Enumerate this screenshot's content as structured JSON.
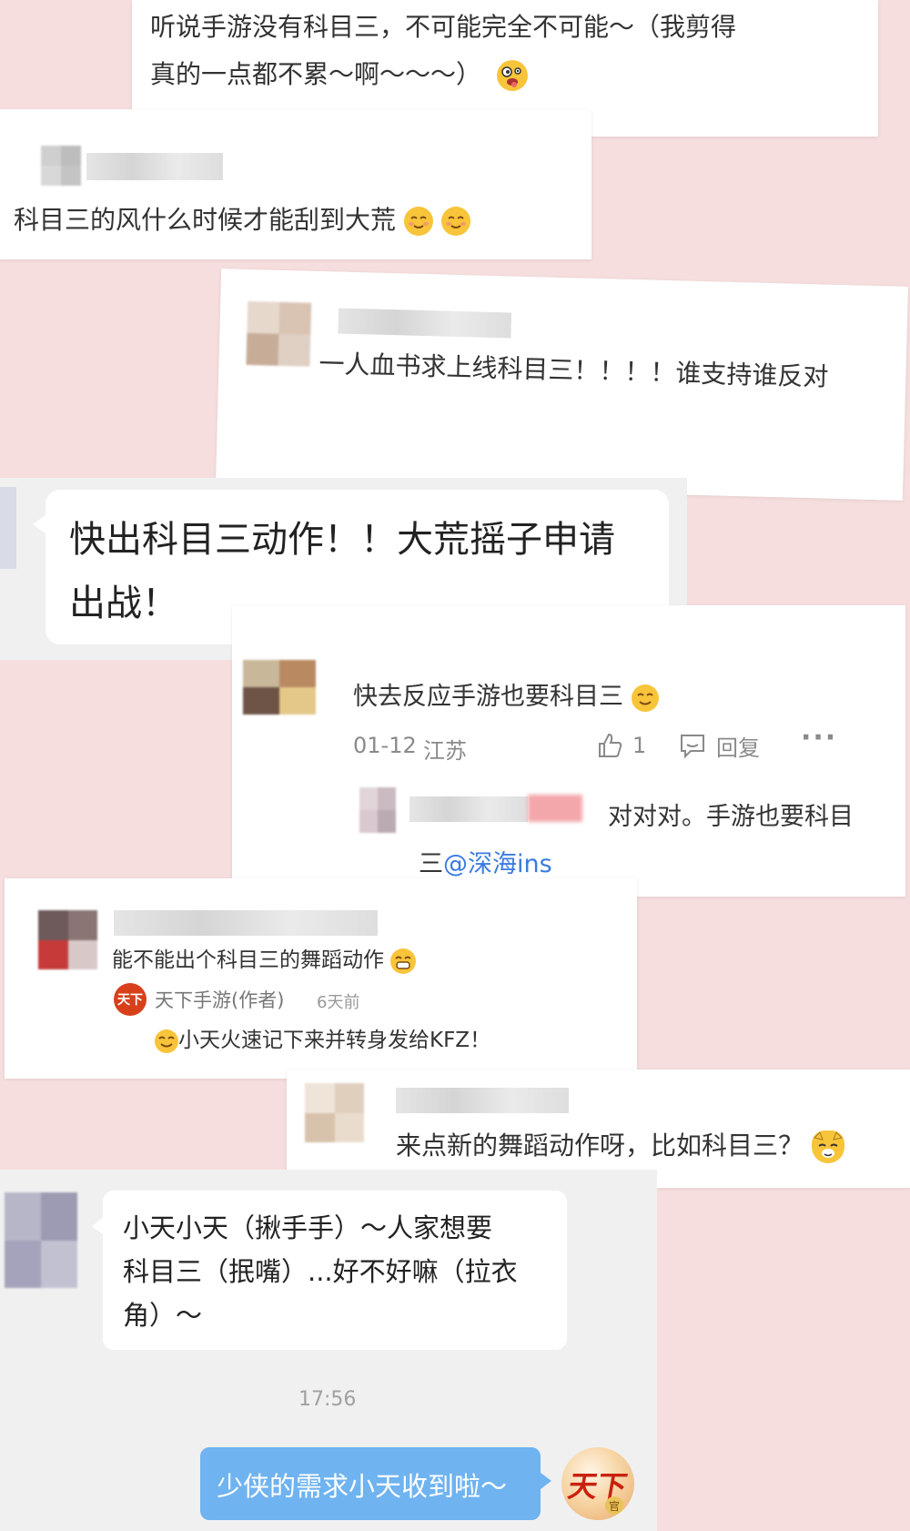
{
  "comment1": {
    "text_line1": "听说手游没有科目三，不可能完全不可能～（我剪得",
    "text_line2": "真的一点都不累～啊～～～）"
  },
  "comment2": {
    "text": "科目三的风什么时候才能刮到大荒"
  },
  "comment3": {
    "text": "一人血书求上线科目三！！！！谁支持谁反对"
  },
  "chat1": {
    "line1": "快出科目三动作！！大荒摇子申请",
    "line2": "出战！"
  },
  "comment4": {
    "text": "快去反应手游也要科目三",
    "date": "01-12",
    "location": "江苏",
    "like_count": "1",
    "reply_label": "回复",
    "more_label": "···",
    "reply_text_line1": "对对对。手游也要科目",
    "reply_text_line2_prefix": "三",
    "reply_mention": "@深海ins"
  },
  "comment5": {
    "text": "能不能出个科目三的舞蹈动作",
    "author_name": "天下手游(作者)",
    "author_time": "6天前",
    "author_reply": "小天火速记下来并转身发给KFZ！",
    "logo_text": "天下"
  },
  "comment6": {
    "text": "来点新的舞蹈动作呀，比如科目三？"
  },
  "chat2": {
    "line1": "小天小天（揪手手）～人家想要",
    "line2": "科目三（抿嘴）...好不好嘛（拉衣",
    "line3": "角）～"
  },
  "chat_time": "17:56",
  "reply_bubble": {
    "text": "少侠的需求小天收到啦～"
  },
  "official_avatar": {
    "logo_text": "天下",
    "badge": "官"
  },
  "colors": {
    "background_pink": "#f6dede",
    "reply_bubble_blue": "#6fb3f0",
    "link_blue": "#3a7be0",
    "emoji_yellow": "#f8c43a"
  }
}
